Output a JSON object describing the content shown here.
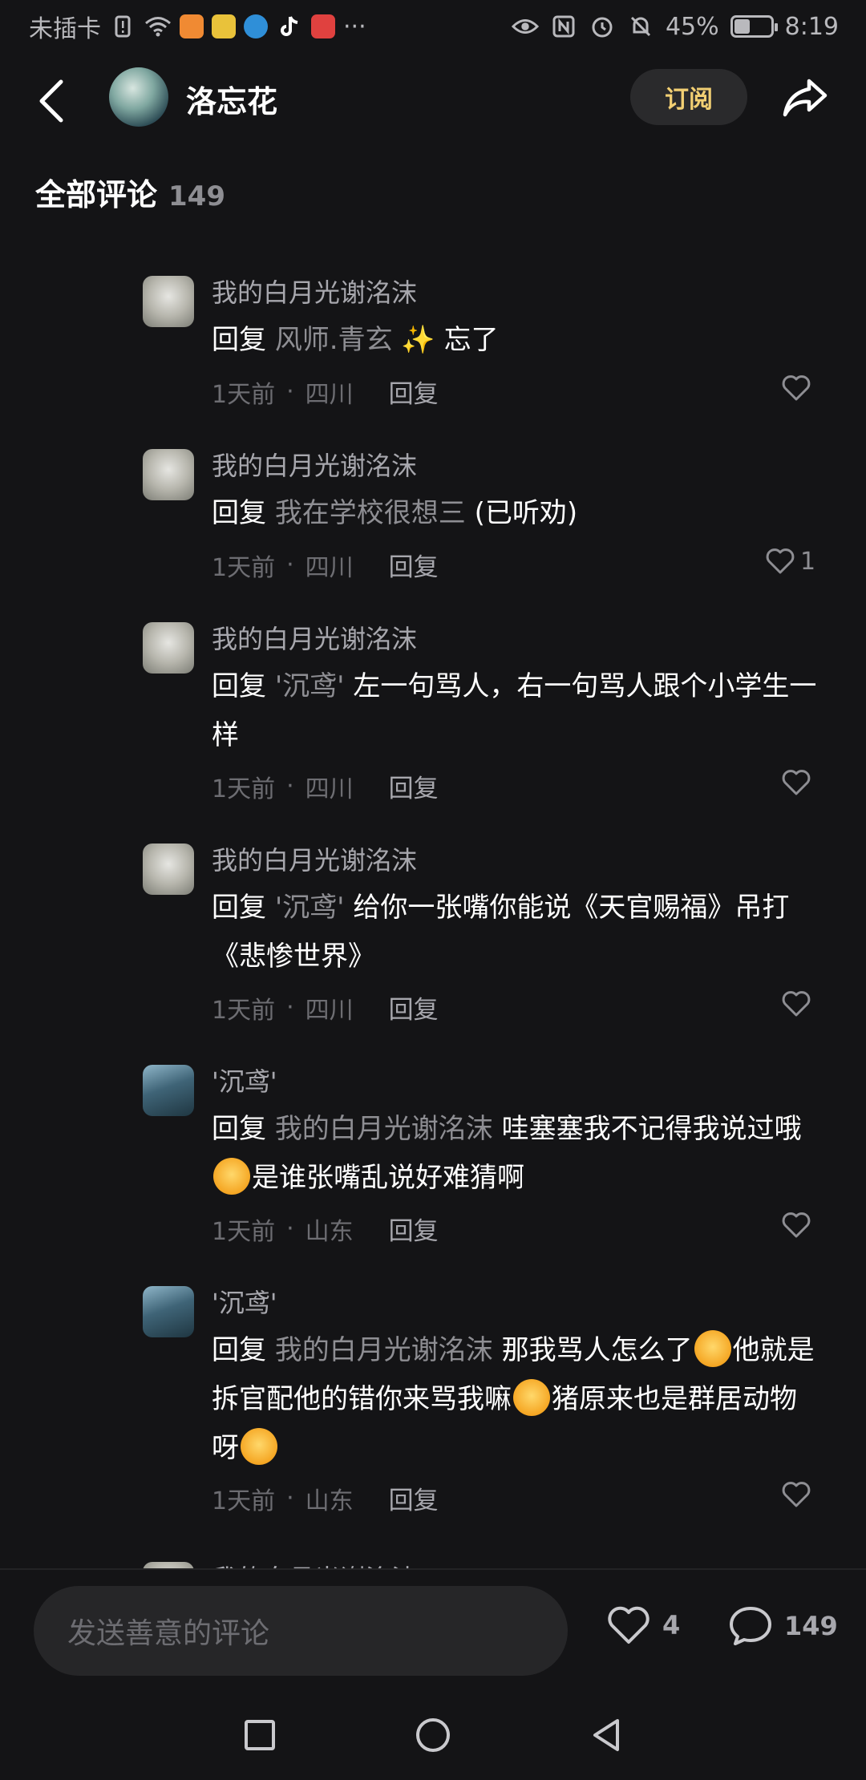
{
  "status_bar": {
    "carrier": "未插卡",
    "battery": "45%",
    "battery_level": 0.45,
    "time": "8:19",
    "more": "···"
  },
  "header": {
    "channel_name": "洛忘花",
    "subscribe_label": "订阅"
  },
  "section": {
    "title": "全部评论",
    "count": "149"
  },
  "comments": [
    {
      "author": "我的白月光谢洺沫",
      "reply_keyword": "回复",
      "target": "风师.青玄",
      "text_a": "",
      "text_b": "忘了",
      "time": "1天前",
      "location": "四川",
      "reply_label": "回复",
      "likes": ""
    },
    {
      "author": "我的白月光谢洺沫",
      "reply_keyword": "回复",
      "target": "我在学校很想三",
      "text_a": "(已听劝)",
      "time": "1天前",
      "location": "四川",
      "reply_label": "回复",
      "likes": "1"
    },
    {
      "author": "我的白月光谢洺沫",
      "reply_keyword": "回复",
      "target": "'沉鸢'",
      "text_a": "左一句骂人，右一句骂人跟个小学生一样",
      "time": "1天前",
      "location": "四川",
      "reply_label": "回复",
      "likes": ""
    },
    {
      "author": "我的白月光谢洺沫",
      "reply_keyword": "回复",
      "target": "'沉鸢'",
      "text_a": "给你一张嘴你能说《天官赐福》吊打《悲惨世界》",
      "time": "1天前",
      "location": "四川",
      "reply_label": "回复",
      "likes": ""
    },
    {
      "author": "'沉鸢'",
      "reply_keyword": "回复",
      "target": "我的白月光谢洺沫",
      "text_a": "哇塞塞我不记得我说过哦",
      "text_b": "是谁张嘴乱说好难猜啊",
      "time": "1天前",
      "location": "山东",
      "reply_label": "回复",
      "likes": ""
    },
    {
      "author": "'沉鸢'",
      "reply_keyword": "回复",
      "target": "我的白月光谢洺沫",
      "text_a": "那我骂人怎么了",
      "text_b": "他就是拆官配他的错你来骂我嘛",
      "text_c": "猪原来也是群居动物呀",
      "time": "1天前",
      "location": "山东",
      "reply_label": "回复",
      "likes": ""
    }
  ],
  "partial_next_author": "我的白月光谢洺沫",
  "bottom_bar": {
    "input_placeholder": "发送善意的评论",
    "like_count": "4",
    "comment_count": "149"
  },
  "icons": {
    "back": "back-arrow-icon",
    "share": "share-icon",
    "like": "heart-icon",
    "comment": "comment-bubble-icon"
  },
  "colors": {
    "background": "#141416",
    "subscribe_text": "#f2cf73",
    "secondary_text": "#8e8e93"
  }
}
